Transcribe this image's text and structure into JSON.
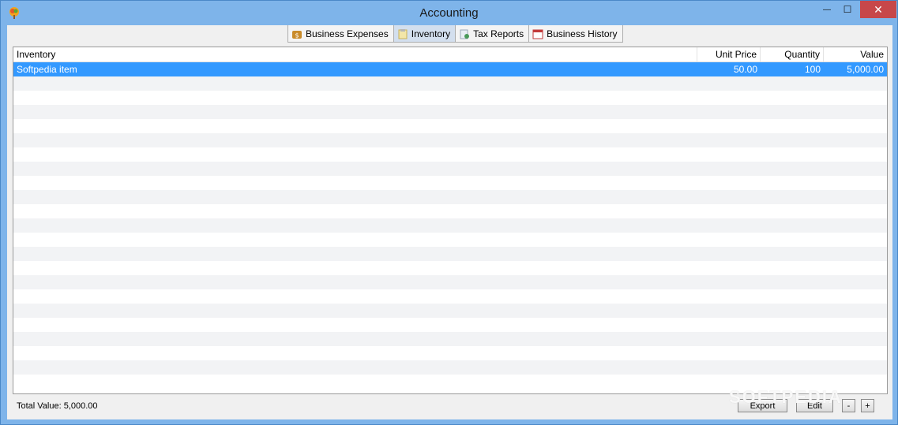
{
  "window": {
    "title": "Accounting",
    "minimize_glyph": "—",
    "maximize_glyph": "☐",
    "close_glyph": "✕",
    "icon": "app-icon"
  },
  "tabs": [
    {
      "label": "Business Expenses",
      "icon": "money-bag-icon",
      "active": false
    },
    {
      "label": "Inventory",
      "icon": "clipboard-icon",
      "active": true
    },
    {
      "label": "Tax Reports",
      "icon": "tax-report-icon",
      "active": false
    },
    {
      "label": "Business History",
      "icon": "calendar-icon",
      "active": false
    }
  ],
  "table": {
    "columns": [
      "Inventory",
      "Unit Price",
      "Quantity",
      "Value"
    ],
    "rows": [
      {
        "name": "Softpedia item",
        "unit_price": "50.00",
        "quantity": "100",
        "value": "5,000.00",
        "selected": true
      }
    ]
  },
  "footer": {
    "total_label": "Total Value: 5,000.00",
    "export_label": "Export",
    "edit_label": "Edit",
    "minus_label": "-",
    "plus_label": "+"
  },
  "watermark": "SOFTPEDIA"
}
